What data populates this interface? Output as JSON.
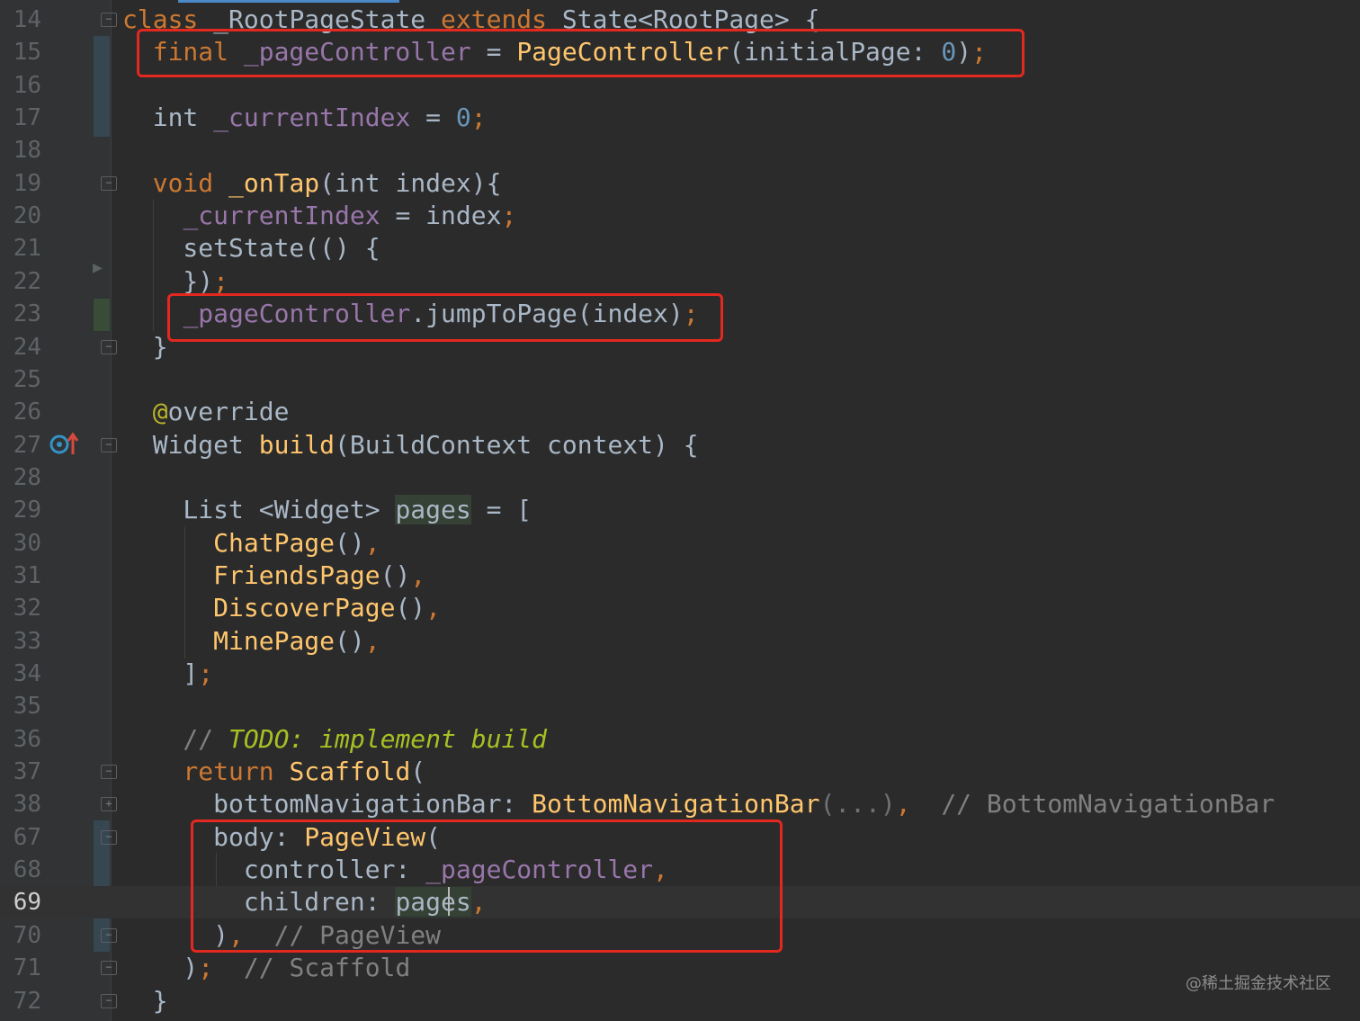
{
  "editor": {
    "language": "Dart",
    "current_line": "69",
    "lines": [
      {
        "num": "14",
        "tokens": [
          {
            "t": "class",
            "c": "kw"
          },
          {
            "t": " _RootPageState ",
            "c": ""
          },
          {
            "t": "extends",
            "c": "kw"
          },
          {
            "t": " State<RootPage> {",
            "c": ""
          }
        ]
      },
      {
        "num": "15",
        "tokens": [
          {
            "t": "  final ",
            "c": "kw"
          },
          {
            "t": "_pageController",
            "c": "fld"
          },
          {
            "t": " = ",
            "c": ""
          },
          {
            "t": "PageController",
            "c": "fn"
          },
          {
            "t": "(initialPage: ",
            "c": ""
          },
          {
            "t": "0",
            "c": "num"
          },
          {
            "t": ")",
            "c": ""
          },
          {
            "t": ";",
            "c": "kw"
          }
        ]
      },
      {
        "num": "16",
        "tokens": []
      },
      {
        "num": "17",
        "tokens": [
          {
            "t": "  int ",
            "c": ""
          },
          {
            "t": "_currentIndex",
            "c": "fld"
          },
          {
            "t": " = ",
            "c": ""
          },
          {
            "t": "0",
            "c": "num"
          },
          {
            "t": ";",
            "c": "kw"
          }
        ]
      },
      {
        "num": "18",
        "tokens": []
      },
      {
        "num": "19",
        "tokens": [
          {
            "t": "  void ",
            "c": "kw"
          },
          {
            "t": "_onTap",
            "c": "fn"
          },
          {
            "t": "(int index){",
            "c": ""
          }
        ]
      },
      {
        "num": "20",
        "tokens": [
          {
            "t": "    ",
            "c": ""
          },
          {
            "t": "_currentIndex",
            "c": "fld"
          },
          {
            "t": " = index",
            "c": ""
          },
          {
            "t": ";",
            "c": "kw"
          }
        ]
      },
      {
        "num": "21",
        "tokens": [
          {
            "t": "    setState(() {",
            "c": ""
          }
        ]
      },
      {
        "num": "22",
        "tokens": [
          {
            "t": "    })",
            "c": ""
          },
          {
            "t": ";",
            "c": "kw"
          }
        ]
      },
      {
        "num": "23",
        "tokens": [
          {
            "t": "    ",
            "c": ""
          },
          {
            "t": "_pageController",
            "c": "fld"
          },
          {
            "t": ".jumpToPage(index)",
            "c": ""
          },
          {
            "t": ";",
            "c": "kw"
          }
        ]
      },
      {
        "num": "24",
        "tokens": [
          {
            "t": "  }",
            "c": ""
          }
        ]
      },
      {
        "num": "25",
        "tokens": []
      },
      {
        "num": "26",
        "tokens": [
          {
            "t": "  @",
            "c": "ann"
          },
          {
            "t": "override",
            "c": ""
          }
        ]
      },
      {
        "num": "27",
        "tokens": [
          {
            "t": "  Widget ",
            "c": ""
          },
          {
            "t": "build",
            "c": "fn"
          },
          {
            "t": "(BuildContext context) {",
            "c": ""
          }
        ]
      },
      {
        "num": "28",
        "tokens": []
      },
      {
        "num": "29",
        "tokens": [
          {
            "t": "    List <Widget> ",
            "c": ""
          },
          {
            "t": "pages",
            "c": "hl"
          },
          {
            "t": " = [",
            "c": ""
          }
        ]
      },
      {
        "num": "30",
        "tokens": [
          {
            "t": "      ",
            "c": ""
          },
          {
            "t": "ChatPage",
            "c": "fn"
          },
          {
            "t": "()",
            "c": ""
          },
          {
            "t": ",",
            "c": "kw"
          }
        ]
      },
      {
        "num": "31",
        "tokens": [
          {
            "t": "      ",
            "c": ""
          },
          {
            "t": "FriendsPage",
            "c": "fn"
          },
          {
            "t": "()",
            "c": ""
          },
          {
            "t": ",",
            "c": "kw"
          }
        ]
      },
      {
        "num": "32",
        "tokens": [
          {
            "t": "      ",
            "c": ""
          },
          {
            "t": "DiscoverPage",
            "c": "fn"
          },
          {
            "t": "()",
            "c": ""
          },
          {
            "t": ",",
            "c": "kw"
          }
        ]
      },
      {
        "num": "33",
        "tokens": [
          {
            "t": "      ",
            "c": ""
          },
          {
            "t": "MinePage",
            "c": "fn"
          },
          {
            "t": "()",
            "c": ""
          },
          {
            "t": ",",
            "c": "kw"
          }
        ]
      },
      {
        "num": "34",
        "tokens": [
          {
            "t": "    ]",
            "c": ""
          },
          {
            "t": ";",
            "c": "kw"
          }
        ]
      },
      {
        "num": "35",
        "tokens": []
      },
      {
        "num": "36",
        "tokens": [
          {
            "t": "    // ",
            "c": "cm"
          },
          {
            "t": "TODO: implement build",
            "c": "todo"
          }
        ]
      },
      {
        "num": "37",
        "tokens": [
          {
            "t": "    return ",
            "c": "kw"
          },
          {
            "t": "Scaffold",
            "c": "fn"
          },
          {
            "t": "(",
            "c": ""
          }
        ]
      },
      {
        "num": "38",
        "tokens": [
          {
            "t": "      bottomNavigationBar: ",
            "c": ""
          },
          {
            "t": "BottomNavigationBar",
            "c": "fn"
          },
          {
            "t": "(...)",
            "c": "dim"
          },
          {
            "t": ",",
            "c": "kw"
          },
          {
            "t": "  // BottomNavigationBar",
            "c": "cm"
          }
        ]
      },
      {
        "num": "67",
        "tokens": [
          {
            "t": "      body: ",
            "c": ""
          },
          {
            "t": "PageView",
            "c": "fn"
          },
          {
            "t": "(",
            "c": ""
          }
        ]
      },
      {
        "num": "68",
        "tokens": [
          {
            "t": "        controller: ",
            "c": ""
          },
          {
            "t": "_pageController",
            "c": "fld"
          },
          {
            "t": ",",
            "c": "kw"
          }
        ]
      },
      {
        "num": "69",
        "tokens": [
          {
            "t": "        children: ",
            "c": ""
          },
          {
            "t": "pages",
            "c": "hl"
          },
          {
            "t": ",",
            "c": "kw"
          }
        ]
      },
      {
        "num": "70",
        "tokens": [
          {
            "t": "      )",
            "c": ""
          },
          {
            "t": ",",
            "c": "kw"
          },
          {
            "t": "  // PageView",
            "c": "cm"
          }
        ]
      },
      {
        "num": "71",
        "tokens": [
          {
            "t": "    )",
            "c": ""
          },
          {
            "t": ";",
            "c": "kw"
          },
          {
            "t": "  // Scaffold",
            "c": "cm"
          }
        ]
      },
      {
        "num": "72",
        "tokens": [
          {
            "t": "  }",
            "c": ""
          }
        ]
      }
    ]
  },
  "gutter": {
    "fold_markers": {
      "14": "open",
      "19": "open",
      "24": "close",
      "27": "open",
      "37": "open",
      "38": "collapsed",
      "67": "open",
      "70": "close",
      "71": "close",
      "72": "close"
    },
    "override_icon": "override-method-icon",
    "run_marker_icon": "triangle-marker-icon"
  },
  "watermark": "@稀土掘金技术社区",
  "colors": {
    "background": "#2b2b2b",
    "keyword": "#cc7832",
    "field": "#9876aa",
    "function": "#ffc66d",
    "number": "#6897bb",
    "comment": "#808080",
    "todo": "#a8c023",
    "highlight_box": "#e3281f"
  }
}
